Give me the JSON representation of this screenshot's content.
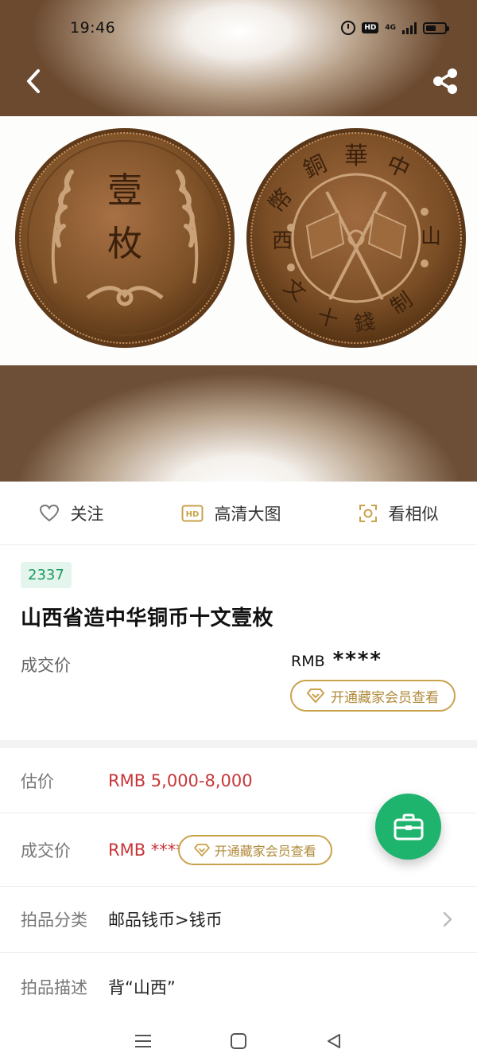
{
  "status_bar": {
    "time": "19:46",
    "hd_label": "HD",
    "network_label": "4G",
    "icons": [
      "alarm-icon",
      "hd-icon",
      "signal-icon",
      "battery-icon"
    ]
  },
  "header": {
    "back_icon": "chevron-left-icon",
    "share_icon": "share-icon"
  },
  "image": {
    "description_icons": [
      "coin-obverse",
      "coin-reverse"
    ],
    "obverse_chars": [
      "壹",
      "枚"
    ],
    "reverse_top_chars": [
      "中",
      "華",
      "銅",
      "幣"
    ],
    "reverse_left_char": "西",
    "reverse_right_char": "山",
    "reverse_bottom_chars": [
      "文",
      "十",
      "錢",
      "制"
    ]
  },
  "actions": [
    {
      "label": "关注",
      "icon": "heart-icon"
    },
    {
      "label": "高清大图",
      "icon": "hd-image-icon"
    },
    {
      "label": "看相似",
      "icon": "scan-icon"
    }
  ],
  "lot": {
    "number": "2337",
    "title": "山西省造中华铜币十文壹枚",
    "deal_label": "成交价",
    "deal_currency": "RMB",
    "deal_mask": "****",
    "vip_button": "开通藏家会员查看"
  },
  "details": {
    "estimate_label": "估价",
    "estimate_value": "RMB  5,000-8,000",
    "deal_label": "成交价",
    "deal_value": "RMB ****",
    "deal_vip_button": "开通藏家会员查看",
    "category_label": "拍品分类",
    "category_value": "邮品钱币>钱币",
    "desc_label": "拍品描述",
    "desc_value": "背“山西”"
  },
  "fab": {
    "icon": "briefcase-icon"
  },
  "system_nav": [
    "menu-icon",
    "home-square-icon",
    "back-triangle-icon"
  ],
  "colors": {
    "accent_green": "#1fb46d",
    "badge_green": "#1e9a5f",
    "price_red": "#c8363a",
    "vip_gold": "#c9a24b",
    "coin_copper": "#8a5a2e"
  }
}
